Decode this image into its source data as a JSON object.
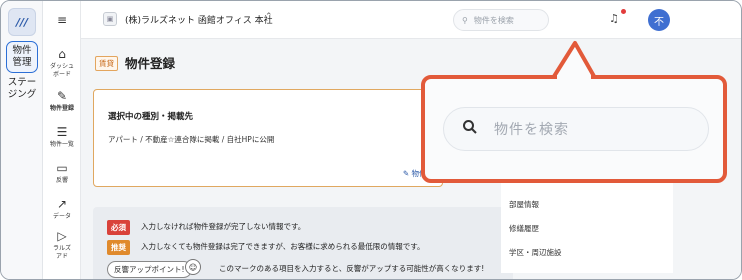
{
  "rail": {
    "logo": "///",
    "items": [
      {
        "label_line1": "物件",
        "label_line2": "管理",
        "active": true
      },
      {
        "label_line1": "ステー",
        "label_line2": "ジング",
        "active": false
      }
    ]
  },
  "nav": {
    "menu_icon": "menu-icon",
    "items": [
      {
        "icon": "home-icon",
        "label_line1": "ダッシュ",
        "label_line2": "ボード"
      },
      {
        "icon": "pencil-icon",
        "label_line1": "物件登録",
        "label_line2": ""
      },
      {
        "icon": "list-icon",
        "label_line1": "物件一覧",
        "label_line2": ""
      },
      {
        "icon": "chat-icon",
        "label_line1": "反響",
        "label_line2": ""
      },
      {
        "icon": "trend-icon",
        "label_line1": "データ",
        "label_line2": ""
      },
      {
        "icon": "flag-icon",
        "label_line1": "ラルズ",
        "label_line2": "アド"
      }
    ]
  },
  "header": {
    "org_name": "(株)ラルズネット 函館オフィス 本社",
    "search_placeholder": "物件を検索",
    "avatar_initial": "不"
  },
  "main": {
    "lease_tag": "賃貸",
    "page_title": "物件登録",
    "selection": {
      "title": "選択中の種別・掲載先",
      "path": "アパート / 不動産☆連合隊に掲載 / 自社HPに公開",
      "link": "物件種"
    },
    "info": {
      "required_badge": "必須",
      "required_text": "入力しなければ物件登録が完了しない情報です。",
      "recommended_badge": "推奨",
      "recommended_text": "入力しなくても物件登録は完了できますが、お客様に求められる最低限の情報です。",
      "appeal_pill": "反響アップポイント!",
      "appeal_text": "このマークのある項目を入力すると、反響がアップする可能性が高くなります!"
    },
    "side_links": [
      "部屋情報",
      "修繕履歴",
      "学区・周辺施設"
    ]
  },
  "callout": {
    "search_placeholder": "物件を検索"
  },
  "colors": {
    "accent": "#2c6fd6",
    "callout_border": "#e25a3a",
    "required": "#d9423a",
    "recommended": "#e08a2c",
    "avatar": "#3f6fd1"
  }
}
